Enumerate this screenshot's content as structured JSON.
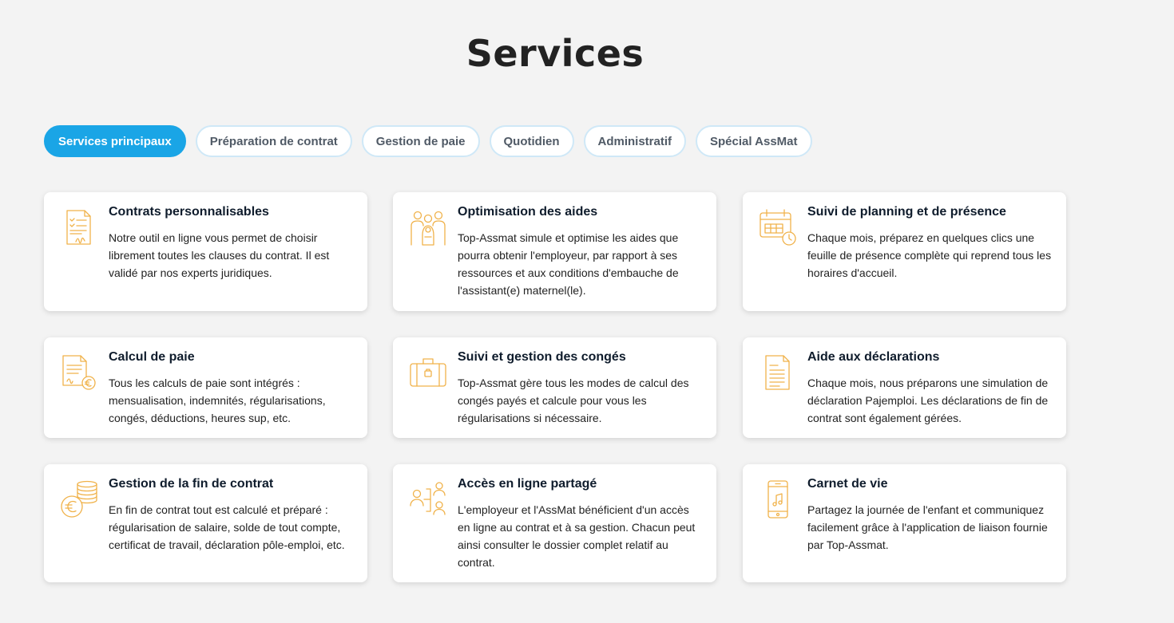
{
  "page": {
    "title": "Services"
  },
  "tabs": [
    {
      "label": "Services principaux",
      "active": true
    },
    {
      "label": "Préparation de contrat",
      "active": false
    },
    {
      "label": "Gestion de paie",
      "active": false
    },
    {
      "label": "Quotidien",
      "active": false
    },
    {
      "label": "Administratif",
      "active": false
    },
    {
      "label": "Spécial AssMat",
      "active": false
    }
  ],
  "services": [
    {
      "title": "Contrats personnalisables",
      "description": "Notre outil en ligne vous permet de choisir librement toutes les clauses du contrat. Il est validé par nos experts juridiques.",
      "icon": "contract-document-icon"
    },
    {
      "title": "Optimisation des aides",
      "description": "Top-Assmat simule et optimise les aides que pourra obtenir l'employeur, par rapport à ses ressources et aux conditions d'embauche de l'assistant(e) maternel(le).",
      "icon": "family-icon"
    },
    {
      "title": "Suivi de planning et de présence",
      "description": "Chaque mois, préparez en quelques clics une feuille de présence complète qui reprend tous les horaires d'accueil.",
      "icon": "calendar-clock-icon"
    },
    {
      "title": "Calcul de paie",
      "description": "Tous les calculs de paie sont intégrés : mensualisation, indemnités, régularisations, congés, déductions, heures sup, etc.",
      "icon": "payslip-euro-icon"
    },
    {
      "title": "Suivi et gestion des congés",
      "description": "Top-Assmat gère tous les modes de calcul des congés payés et calcule pour vous les régularisations si nécessaire.",
      "icon": "suitcase-icon"
    },
    {
      "title": "Aide aux déclarations",
      "description": "Chaque mois, nous préparons une simulation de déclaration Pajemploi. Les déclarations de fin de contrat sont également gérées.",
      "icon": "declaration-document-icon"
    },
    {
      "title": "Gestion de la fin de contrat",
      "description": "En fin de contrat tout est calculé et préparé : régularisation de salaire, solde de tout compte, certificat de travail, déclaration pôle-emploi, etc.",
      "icon": "coins-euro-icon"
    },
    {
      "title": "Accès en ligne partagé",
      "description": "L'employeur et l'AssMat bénéficient d'un accès en ligne au contrat et à sa gestion. Chacun peut ainsi consulter le dossier complet relatif au contrat.",
      "icon": "shared-users-icon"
    },
    {
      "title": "Carnet de vie",
      "description": "Partagez la journée de l'enfant et communiquez facilement grâce à l'application de liaison fournie par Top-Assmat.",
      "icon": "smartphone-music-icon"
    }
  ],
  "colors": {
    "accent": "#1aa5e6",
    "icon": "#f0b24a",
    "tab_border": "#cfe8f7",
    "background": "#f3f3f3"
  }
}
